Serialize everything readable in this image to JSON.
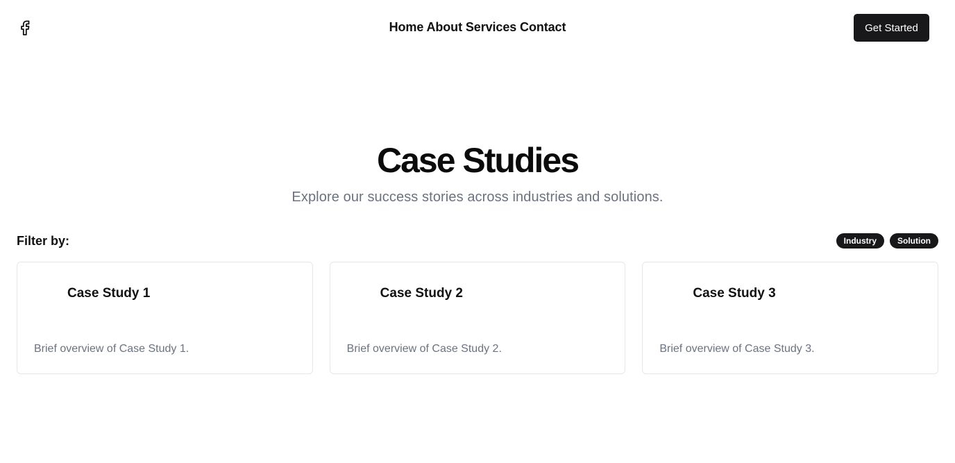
{
  "header": {
    "logo_icon": "facebook-icon",
    "nav": [
      {
        "label": "Home"
      },
      {
        "label": "About"
      },
      {
        "label": "Services"
      },
      {
        "label": "Contact"
      }
    ],
    "cta_label": "Get Started"
  },
  "hero": {
    "title": "Case Studies",
    "subtitle": "Explore our success stories across industries and solutions."
  },
  "filter": {
    "label": "Filter by:",
    "chips": [
      {
        "label": "Industry"
      },
      {
        "label": "Solution"
      }
    ]
  },
  "cards": [
    {
      "title": "Case Study 1",
      "description": "Brief overview of Case Study 1."
    },
    {
      "title": "Case Study 2",
      "description": "Brief overview of Case Study 2."
    },
    {
      "title": "Case Study 3",
      "description": "Brief overview of Case Study 3."
    }
  ],
  "colors": {
    "dark": "#18181b",
    "muted_text": "#6b7280",
    "border": "#e5e7eb"
  }
}
